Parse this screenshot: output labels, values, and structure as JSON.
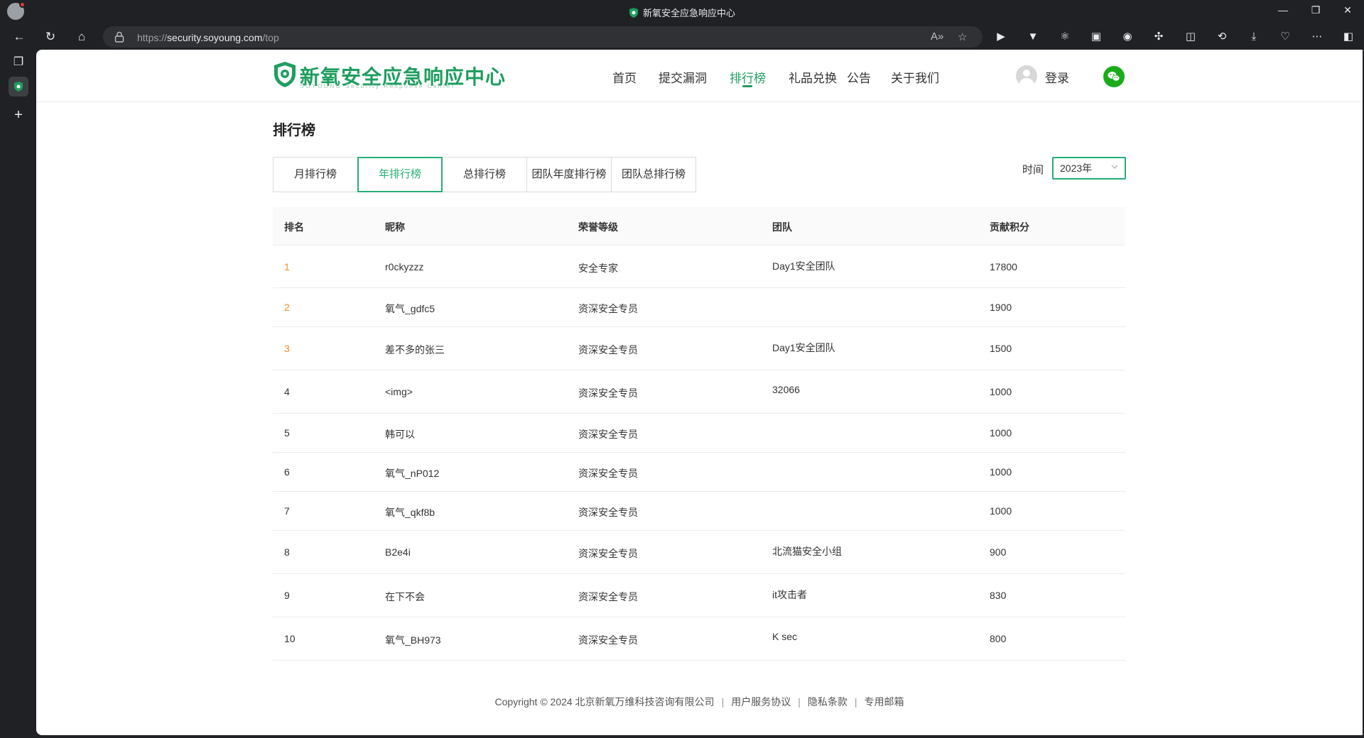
{
  "browser": {
    "window_title": "新氧安全应急响应中心",
    "url_prefix": "https://",
    "url_host": "security.soyoung.com",
    "url_path": "/top"
  },
  "site": {
    "logo_name": "新氧安全应急响应中心",
    "logo_sub": "SOYOUNG Security Response Center",
    "nav": [
      "首页",
      "提交漏洞",
      "排行榜",
      "礼品兑换",
      "公告",
      "关于我们"
    ],
    "active_nav": "排行榜",
    "login_label": "登录"
  },
  "main": {
    "title": "排行榜",
    "tabs": [
      "月排行榜",
      "年排行榜",
      "总排行榜",
      "团队年度排行榜",
      "团队总排行榜"
    ],
    "active_tab": "年排行榜",
    "time_label": "时间",
    "time_value": "2023年"
  },
  "table": {
    "headers": [
      "排名",
      "昵称",
      "荣誉等级",
      "团队",
      "贡献积分"
    ],
    "rows": [
      {
        "rank": "1",
        "nickname": "r0ckyzzz",
        "level": "安全专家",
        "team": "Day1安全团队",
        "points": "17800"
      },
      {
        "rank": "2",
        "nickname": "氧气_gdfc5",
        "level": "资深安全专员",
        "team": "",
        "points": "1900"
      },
      {
        "rank": "3",
        "nickname": "差不多的张三",
        "level": "资深安全专员",
        "team": "Day1安全团队",
        "points": "1500"
      },
      {
        "rank": "4",
        "nickname": "<img>",
        "level": "资深安全专员",
        "team": "32066",
        "points": "1000"
      },
      {
        "rank": "5",
        "nickname": "韩可以",
        "level": "资深安全专员",
        "team": "",
        "points": "1000"
      },
      {
        "rank": "6",
        "nickname": "氧气_nP012",
        "level": "资深安全专员",
        "team": "",
        "points": "1000"
      },
      {
        "rank": "7",
        "nickname": "氧气_qkf8b",
        "level": "资深安全专员",
        "team": "",
        "points": "1000"
      },
      {
        "rank": "8",
        "nickname": "B2e4i",
        "level": "资深安全专员",
        "team": "北流猫安全小组",
        "points": "900"
      },
      {
        "rank": "9",
        "nickname": "在下不会",
        "level": "资深安全专员",
        "team": "it攻击者",
        "points": "830"
      },
      {
        "rank": "10",
        "nickname": "氧气_BH973",
        "level": "资深安全专员",
        "team": "K sec",
        "points": "800"
      }
    ]
  },
  "footer": {
    "copyright": "Copyright © 2024 北京新氧万维科技咨询有限公司",
    "links": [
      "用户服务协议",
      "隐私条款",
      "专用邮箱"
    ]
  },
  "colors": {
    "brand": "#1e9e5f",
    "accent": "#27ae76",
    "top_rank": "#f28c28"
  }
}
